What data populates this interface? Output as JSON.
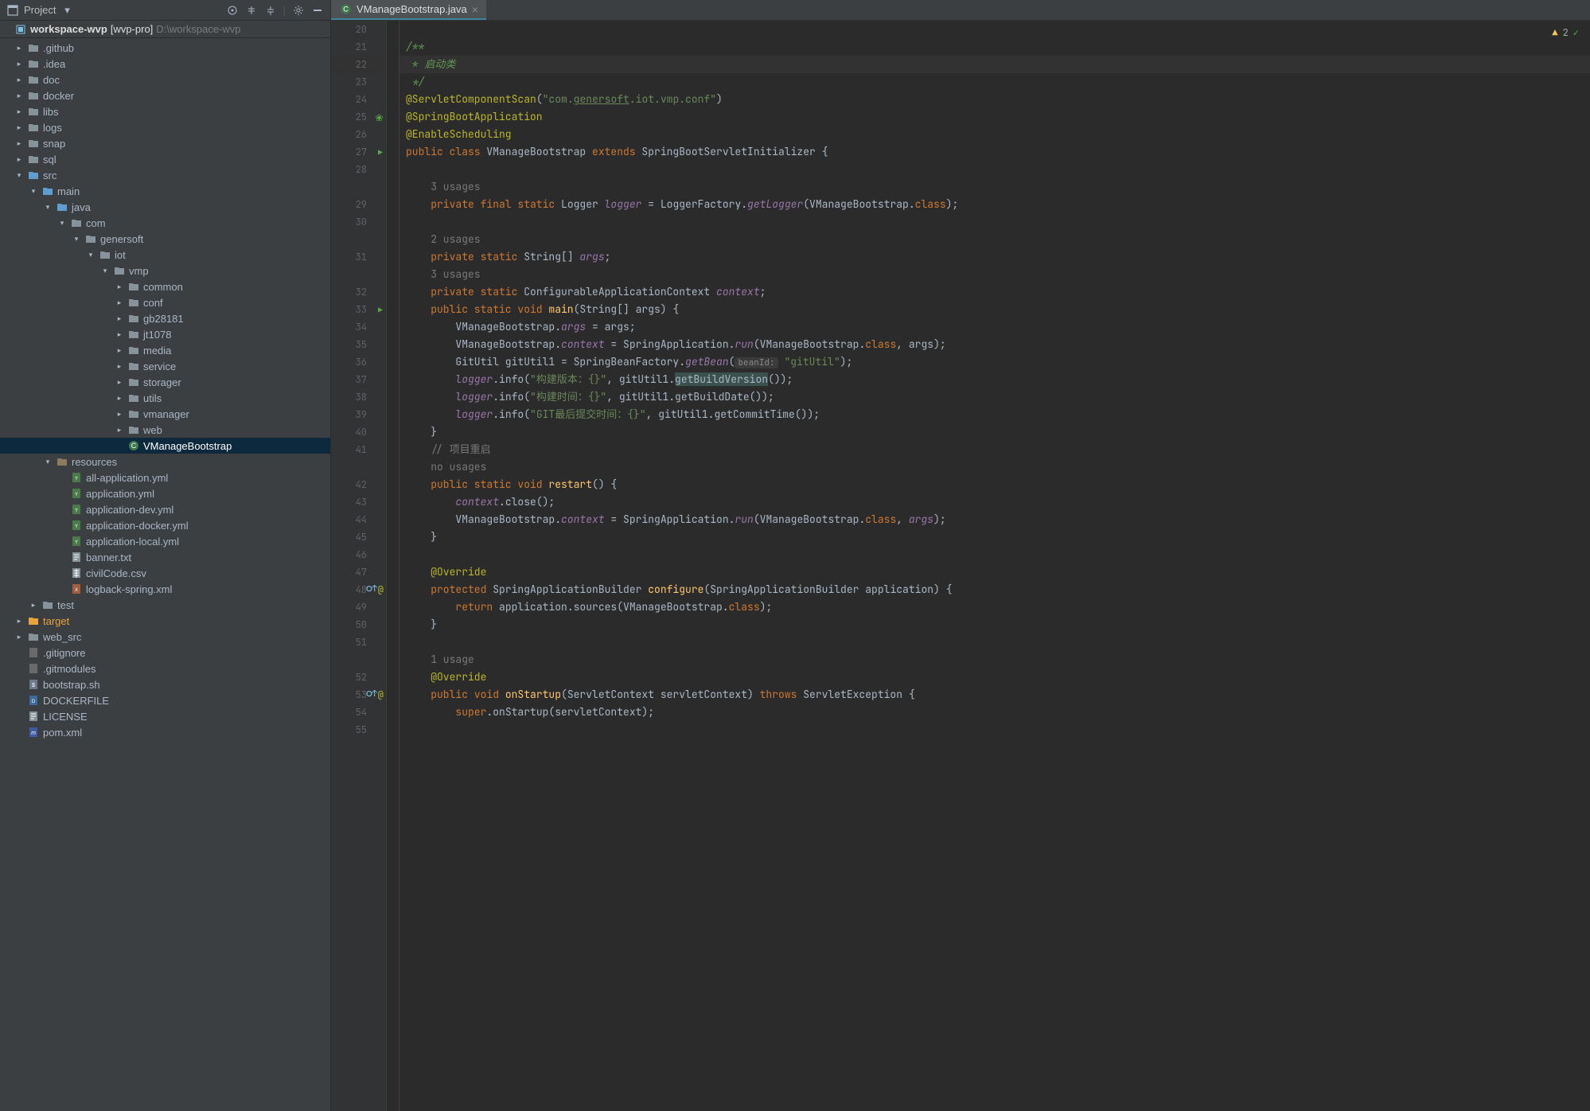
{
  "sidebarHeader": {
    "title": "Project"
  },
  "breadcrumb": {
    "project": "workspace-wvp",
    "module": "[wvp-pro]",
    "path": "D:\\workspace-wvp"
  },
  "projectTree": [
    {
      "depth": 0,
      "arrow": "right",
      "iconType": "folder",
      "label": ".github"
    },
    {
      "depth": 0,
      "arrow": "right",
      "iconType": "folder",
      "label": ".idea"
    },
    {
      "depth": 0,
      "arrow": "right",
      "iconType": "folder",
      "label": "doc"
    },
    {
      "depth": 0,
      "arrow": "right",
      "iconType": "folder",
      "label": "docker"
    },
    {
      "depth": 0,
      "arrow": "right",
      "iconType": "folder",
      "label": "libs"
    },
    {
      "depth": 0,
      "arrow": "right",
      "iconType": "folder",
      "label": "logs"
    },
    {
      "depth": 0,
      "arrow": "right",
      "iconType": "folder",
      "label": "snap"
    },
    {
      "depth": 0,
      "arrow": "right",
      "iconType": "folder",
      "label": "sql"
    },
    {
      "depth": 0,
      "arrow": "down",
      "iconType": "folder-open",
      "label": "src"
    },
    {
      "depth": 1,
      "arrow": "down",
      "iconType": "folder-open",
      "label": "main"
    },
    {
      "depth": 2,
      "arrow": "down",
      "iconType": "folder-src",
      "label": "java"
    },
    {
      "depth": 3,
      "arrow": "down",
      "iconType": "folder-pkg",
      "label": "com"
    },
    {
      "depth": 4,
      "arrow": "down",
      "iconType": "folder-pkg",
      "label": "genersoft"
    },
    {
      "depth": 5,
      "arrow": "down",
      "iconType": "folder-pkg",
      "label": "iot"
    },
    {
      "depth": 6,
      "arrow": "down",
      "iconType": "folder-pkg",
      "label": "vmp"
    },
    {
      "depth": 7,
      "arrow": "right",
      "iconType": "folder-pkg",
      "label": "common"
    },
    {
      "depth": 7,
      "arrow": "right",
      "iconType": "folder-pkg",
      "label": "conf"
    },
    {
      "depth": 7,
      "arrow": "right",
      "iconType": "folder-pkg",
      "label": "gb28181"
    },
    {
      "depth": 7,
      "arrow": "right",
      "iconType": "folder-pkg",
      "label": "jt1078"
    },
    {
      "depth": 7,
      "arrow": "right",
      "iconType": "folder-pkg",
      "label": "media"
    },
    {
      "depth": 7,
      "arrow": "right",
      "iconType": "folder-pkg",
      "label": "service"
    },
    {
      "depth": 7,
      "arrow": "right",
      "iconType": "folder-pkg",
      "label": "storager"
    },
    {
      "depth": 7,
      "arrow": "right",
      "iconType": "folder-pkg",
      "label": "utils"
    },
    {
      "depth": 7,
      "arrow": "right",
      "iconType": "folder-pkg",
      "label": "vmanager"
    },
    {
      "depth": 7,
      "arrow": "right",
      "iconType": "folder-pkg",
      "label": "web"
    },
    {
      "depth": 7,
      "arrow": "none",
      "iconType": "class",
      "label": "VManageBootstrap",
      "sel": true
    },
    {
      "depth": 2,
      "arrow": "down",
      "iconType": "folder-res",
      "label": "resources"
    },
    {
      "depth": 3,
      "arrow": "none",
      "iconType": "yml",
      "label": "all-application.yml"
    },
    {
      "depth": 3,
      "arrow": "none",
      "iconType": "yml",
      "label": "application.yml"
    },
    {
      "depth": 3,
      "arrow": "none",
      "iconType": "yml",
      "label": "application-dev.yml"
    },
    {
      "depth": 3,
      "arrow": "none",
      "iconType": "yml",
      "label": "application-docker.yml"
    },
    {
      "depth": 3,
      "arrow": "none",
      "iconType": "yml",
      "label": "application-local.yml"
    },
    {
      "depth": 3,
      "arrow": "none",
      "iconType": "txt",
      "label": "banner.txt"
    },
    {
      "depth": 3,
      "arrow": "none",
      "iconType": "csv",
      "label": "civilCode.csv"
    },
    {
      "depth": 3,
      "arrow": "none",
      "iconType": "xml",
      "label": "logback-spring.xml"
    },
    {
      "depth": 1,
      "arrow": "right",
      "iconType": "folder",
      "label": "test"
    },
    {
      "depth": 0,
      "arrow": "right",
      "iconType": "folder-target",
      "label": "target",
      "hl": true
    },
    {
      "depth": 0,
      "arrow": "right",
      "iconType": "folder",
      "label": "web_src"
    },
    {
      "depth": 0,
      "arrow": "none",
      "iconType": "file",
      "label": ".gitignore"
    },
    {
      "depth": 0,
      "arrow": "none",
      "iconType": "file",
      "label": ".gitmodules"
    },
    {
      "depth": 0,
      "arrow": "none",
      "iconType": "sh",
      "label": "bootstrap.sh"
    },
    {
      "depth": 0,
      "arrow": "none",
      "iconType": "docker",
      "label": "DOCKERFILE"
    },
    {
      "depth": 0,
      "arrow": "none",
      "iconType": "txt",
      "label": "LICENSE"
    },
    {
      "depth": 0,
      "arrow": "none",
      "iconType": "maven",
      "label": "pom.xml"
    }
  ],
  "tab": {
    "label": "VManageBootstrap.java"
  },
  "indicators": {
    "warningCount": "2"
  },
  "codeLines": [
    {
      "n": "20",
      "html": ""
    },
    {
      "n": "21",
      "html": "<span class='c-cmt'>/**</span>"
    },
    {
      "n": "22",
      "hl": true,
      "html": "<span class='c-cmt'> * 启动类</span>"
    },
    {
      "n": "23",
      "html": "<span class='c-cmt'> */</span>"
    },
    {
      "n": "24",
      "html": "<span class='c-ann'>@ServletComponentScan</span>(<span class='c-str'>\"com.<u>genersoft</u>.iot.vmp.conf\"</span>)"
    },
    {
      "n": "25",
      "leaf": true,
      "html": "<span class='c-ann'>@SpringBootApplication</span>"
    },
    {
      "n": "26",
      "html": "<span class='c-ann'>@EnableScheduling</span>"
    },
    {
      "n": "27",
      "run": true,
      "html": "<span class='c-kwd'>public class </span><span class='c-typ'>VManageBootstrap </span><span class='c-kwd'>extends </span><span class='c-typ'>SpringBootServletInitializer </span>{"
    },
    {
      "n": "28",
      "html": ""
    },
    {
      "n": "",
      "html": "    <span class='c-hint'>3 usages</span>"
    },
    {
      "n": "29",
      "html": "    <span class='c-kwd'>private final static </span><span class='c-typ'>Logger </span><span class='c-fld'>logger</span> = LoggerFactory.<span class='c-fld'>getLogger</span>(VManageBootstrap.<span class='c-kwd'>class</span>);"
    },
    {
      "n": "30",
      "html": ""
    },
    {
      "n": "",
      "html": "    <span class='c-hint'>2 usages</span>"
    },
    {
      "n": "31",
      "html": "    <span class='c-kwd'>private static </span><span class='c-typ'>String[] </span><span class='c-fld'>args</span>;"
    },
    {
      "n": "",
      "html": "    <span class='c-hint'>3 usages</span>"
    },
    {
      "n": "32",
      "html": "    <span class='c-kwd'>private static </span><span class='c-typ'>ConfigurableApplicationContext </span><span class='c-fld'>context</span>;"
    },
    {
      "n": "33",
      "run": true,
      "html": "    <span class='c-kwd'>public static void </span><span class='c-call'>main</span>(String[] args) {"
    },
    {
      "n": "34",
      "html": "        VManageBootstrap.<span class='c-fld'>args</span> = args;"
    },
    {
      "n": "35",
      "html": "        VManageBootstrap.<span class='c-fld'>context</span> = SpringApplication.<span class='c-fld'>run</span>(VManageBootstrap.<span class='c-kwd'>class</span>, args);"
    },
    {
      "n": "36",
      "html": "        GitUtil gitUtil1 = SpringBeanFactory.<span class='c-fld'>getBean</span>(<span class='c-inlay'>beanId:</span> <span class='c-str'>\"gitUtil\"</span>);"
    },
    {
      "n": "37",
      "html": "        <span class='c-fld'>logger</span>.info(<span class='c-str'>\"构建版本：{}\"</span>, gitUtil1.<span style='background:#3b514d;'>getBuildVersion</span>());"
    },
    {
      "n": "38",
      "html": "        <span class='c-fld'>logger</span>.info(<span class='c-str'>\"构建时间：{}\"</span>, gitUtil1.getBuildDate());"
    },
    {
      "n": "39",
      "html": "        <span class='c-fld'>logger</span>.info(<span class='c-str'>\"GIT最后提交时间：{}\"</span>, gitUtil1.getCommitTime());"
    },
    {
      "n": "40",
      "html": "    }"
    },
    {
      "n": "41",
      "html": "    <span class='c-hint'>// 项目重启</span>"
    },
    {
      "n": "",
      "html": "    <span class='c-hint'>no usages</span>"
    },
    {
      "n": "42",
      "html": "    <span class='c-kwd'>public static void </span><span class='c-call'>restart</span>() {"
    },
    {
      "n": "43",
      "html": "        <span class='c-fld'>context</span>.close();"
    },
    {
      "n": "44",
      "html": "        VManageBootstrap.<span class='c-fld'>context</span> = SpringApplication.<span class='c-fld'>run</span>(VManageBootstrap.<span class='c-kwd'>class</span>, <span class='c-fld'>args</span>);"
    },
    {
      "n": "45",
      "html": "    }"
    },
    {
      "n": "46",
      "html": ""
    },
    {
      "n": "47",
      "html": "    <span class='c-ann'>@Override</span>"
    },
    {
      "n": "48",
      "ovr": true,
      "html": "    <span class='c-kwd'>protected </span><span class='c-typ'>SpringApplicationBuilder </span><span class='c-call'>configure</span>(SpringApplicationBuilder application) {"
    },
    {
      "n": "49",
      "html": "        <span class='c-kwd'>return </span>application.sources(VManageBootstrap.<span class='c-kwd'>class</span>);"
    },
    {
      "n": "50",
      "html": "    }"
    },
    {
      "n": "51",
      "html": ""
    },
    {
      "n": "",
      "html": "    <span class='c-hint'>1 usage</span>"
    },
    {
      "n": "52",
      "html": "    <span class='c-ann'>@Override</span>"
    },
    {
      "n": "53",
      "ovr": true,
      "html": "    <span class='c-kwd'>public void </span><span class='c-call'>onStartup</span>(ServletContext servletContext) <span class='c-kwd'>throws </span><span class='c-typ'>ServletException </span>{"
    },
    {
      "n": "54",
      "html": "        <span class='c-kwd'>super</span>.onStartup(servletContext);"
    },
    {
      "n": "55",
      "html": ""
    }
  ]
}
